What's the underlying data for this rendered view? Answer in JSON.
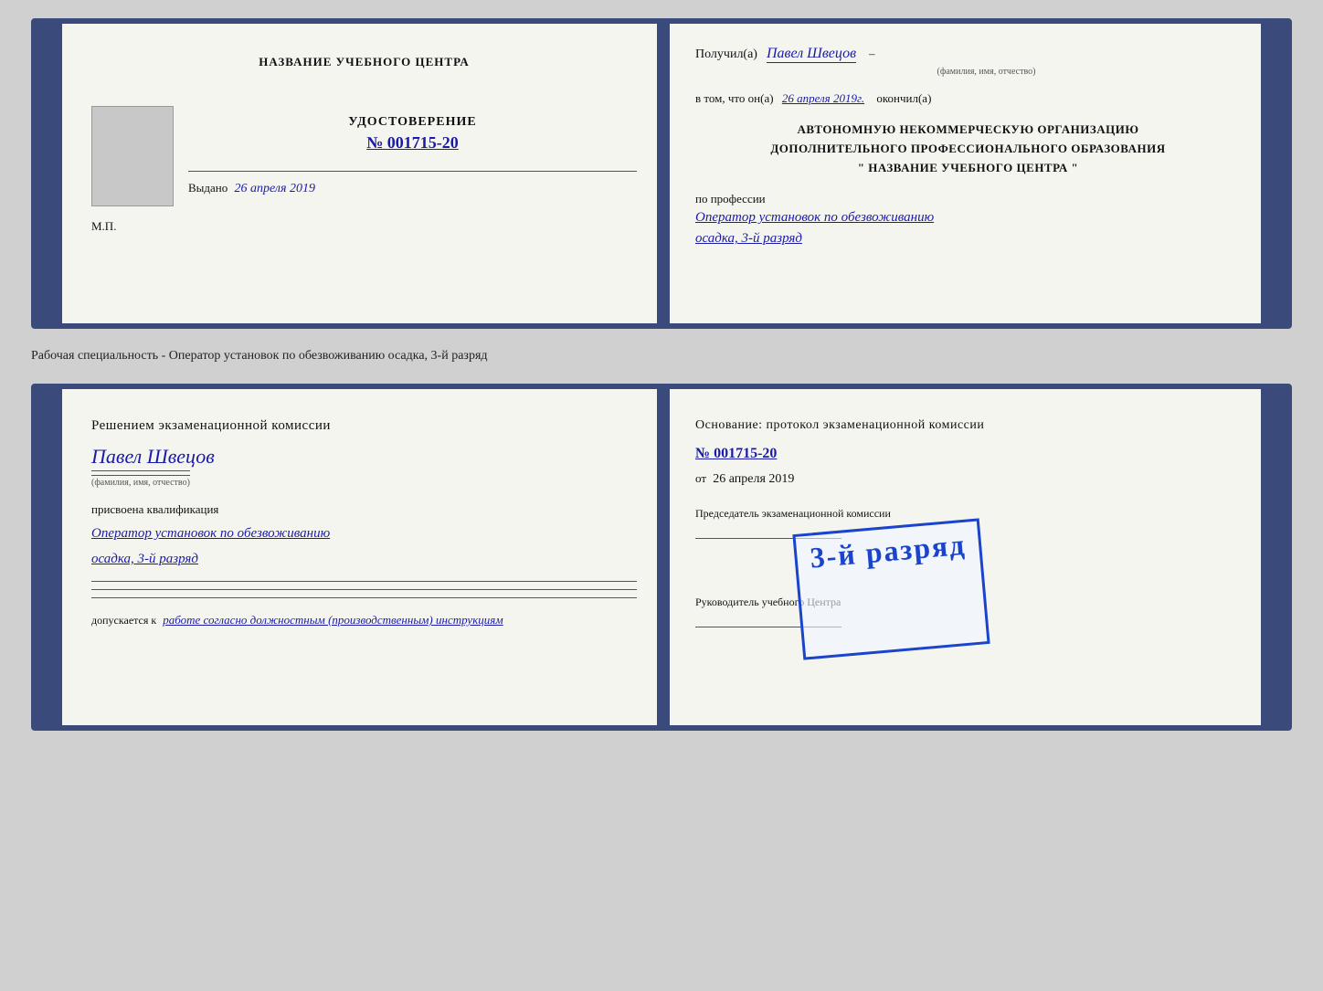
{
  "top_doc": {
    "left": {
      "center_title": "НАЗВАНИЕ УЧЕБНОГО ЦЕНТРА",
      "cert_title": "УДОСТОВЕРЕНИЕ",
      "cert_number": "№ 001715-20",
      "issued_label": "Выдано",
      "issued_date": "26 апреля 2019",
      "mp_label": "М.П."
    },
    "right": {
      "received_label": "Получил(а)",
      "received_name": "Павел Швецов",
      "fio_label": "(фамилия, имя, отчество)",
      "in_that_line": "в том, что он(а)",
      "date_value": "26 апреля 2019г.",
      "finished_label": "окончил(а)",
      "org_line1": "АВТОНОМНУЮ НЕКОММЕРЧЕСКУЮ ОРГАНИЗАЦИЮ",
      "org_line2": "ДОПОЛНИТЕЛЬНОГО ПРОФЕССИОНАЛЬНОГО ОБРАЗОВАНИЯ",
      "org_line3": "\" НАЗВАНИЕ УЧЕБНОГО ЦЕНТРА \"",
      "profession_label": "по профессии",
      "profession_value": "Оператор установок по обезвоживанию",
      "rank_value": "осадка, 3-й разряд"
    }
  },
  "between_label": "Рабочая специальность - Оператор установок по обезвоживанию осадка, 3-й разряд",
  "bottom_doc": {
    "left": {
      "decision_title": "Решением экзаменационной комиссии",
      "person_name": "Павел Швецов",
      "fio_label": "(фамилия, имя, отчество)",
      "qualification_label": "присвоена квалификация",
      "qualification_value": "Оператор установок по обезвоживанию",
      "rank_value": "осадка, 3-й разряд",
      "admission_label": "допускается к",
      "admission_value": "работе согласно должностным (производственным) инструкциям"
    },
    "right": {
      "basis_label": "Основание: протокол экзаменационной комиссии",
      "protocol_number": "№ 001715-20",
      "from_label": "от",
      "from_date": "26 апреля 2019",
      "chairman_label": "Председатель экзаменационной комиссии",
      "director_label": "Руководитель учебного Центра"
    },
    "stamp": {
      "text": "3-й разряд"
    }
  }
}
